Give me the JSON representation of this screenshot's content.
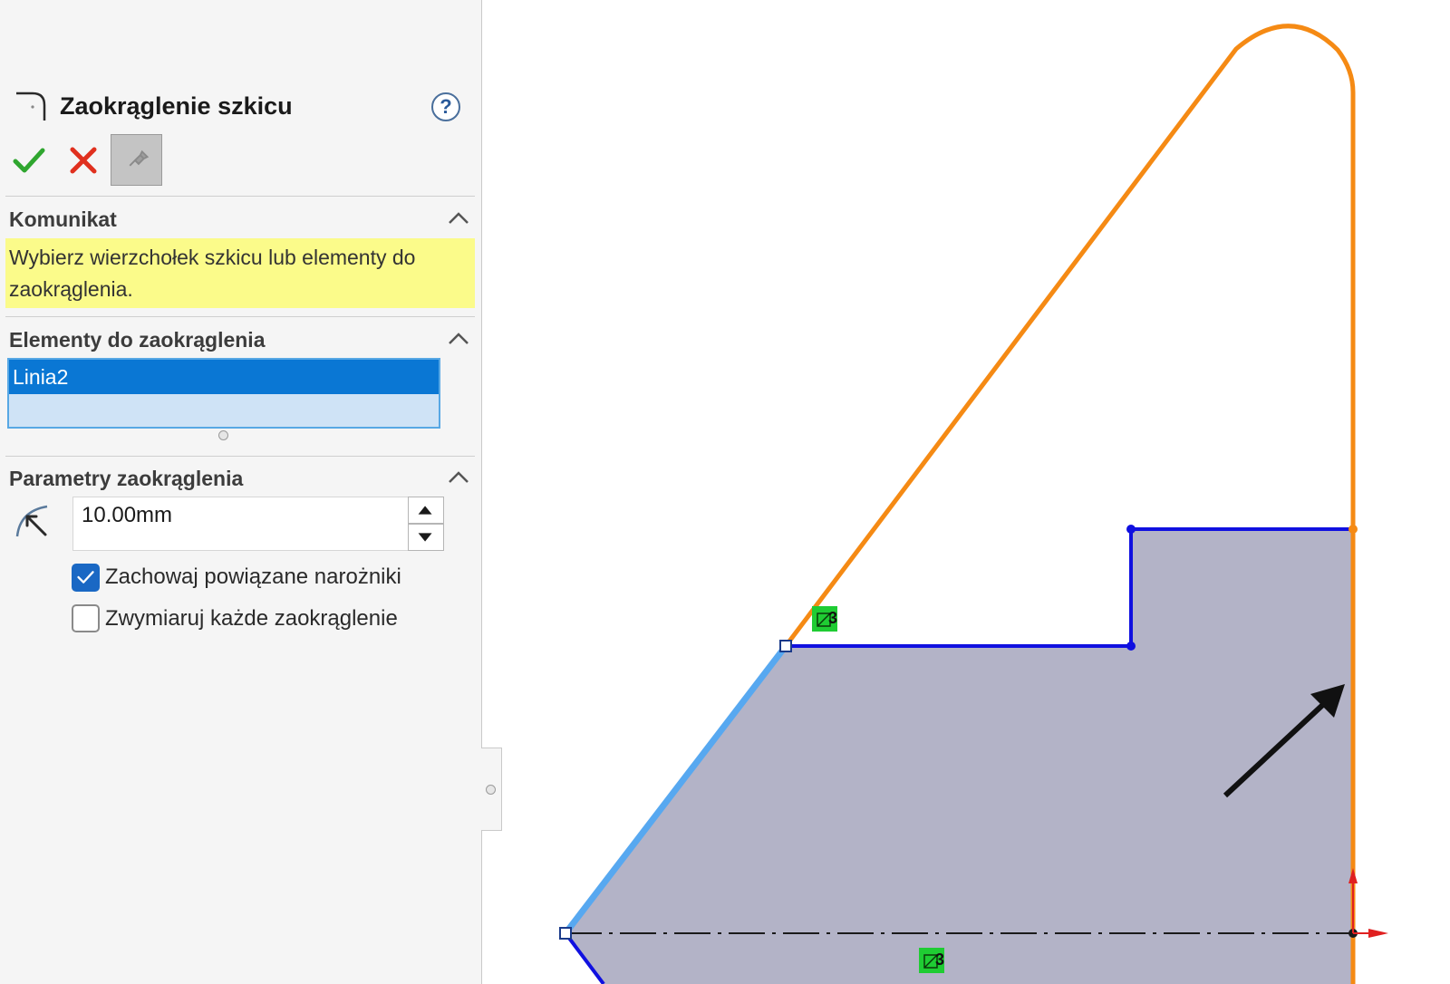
{
  "property_manager": {
    "title": "Zaokrąglenie szkicu",
    "help_glyph": "?",
    "actions": {
      "ok": "check-icon",
      "cancel": "close-icon",
      "pin": "pin-icon"
    },
    "message_section": {
      "title": "Komunikat",
      "text_line1": "Wybierz wierzchołek szkicu lub elementy do",
      "text_line2": "zaokrąglenia."
    },
    "entities_section": {
      "title": "Elementy do zaokrąglenia",
      "items": [
        "Linia2"
      ]
    },
    "parameters_section": {
      "title": "Parametry zaokrąglenia",
      "radius_value": "10.00mm",
      "keep_corners_label": "Zachowaj powiązane narożniki",
      "keep_corners_checked": true,
      "dimension_each_label": "Zwymiaruj każde zaokrąglenie",
      "dimension_each_checked": false
    }
  },
  "colors": {
    "selected_line": "#57a8f0",
    "sketch_line": "#1010e0",
    "orange_line": "#f58a14",
    "region_fill": "#b3b3c7",
    "message_bg": "#fbfb8a",
    "list_selected": "#0a77d4",
    "relation_badge": "#1fcc33"
  },
  "graphics": {
    "relation_badge_text": "3"
  }
}
